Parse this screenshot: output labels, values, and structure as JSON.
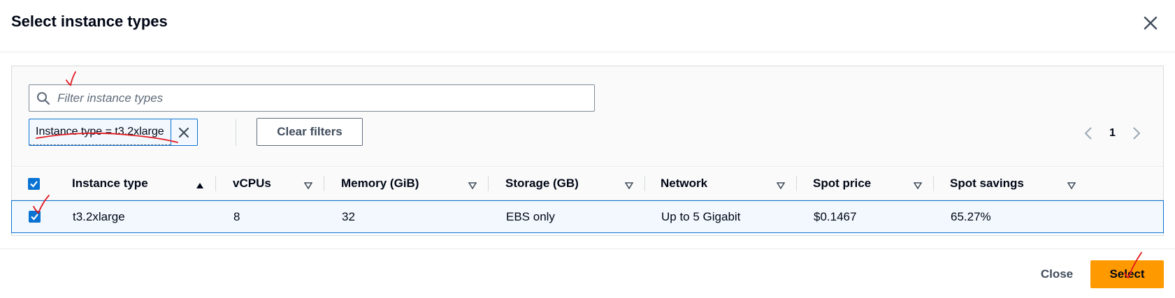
{
  "modal": {
    "title": "Select instance types",
    "close_icon": "close-icon"
  },
  "filter": {
    "placeholder": "Filter instance types",
    "search_icon": "search-icon",
    "token_label": "Instance type = t3.2xlarge",
    "clear_label": "Clear filters"
  },
  "pagination": {
    "current_page": "1"
  },
  "table": {
    "columns": [
      {
        "label": "Instance type",
        "sort": "ascending"
      },
      {
        "label": "vCPUs",
        "sort": "none"
      },
      {
        "label": "Memory (GiB)",
        "sort": "none"
      },
      {
        "label": "Storage (GB)",
        "sort": "none"
      },
      {
        "label": "Network",
        "sort": "none"
      },
      {
        "label": "Spot price",
        "sort": "none"
      },
      {
        "label": "Spot savings",
        "sort": "none"
      }
    ],
    "rows": [
      {
        "selected": true,
        "cells": [
          "t3.2xlarge",
          "8",
          "32",
          "EBS only",
          "Up to 5 Gigabit",
          "$0.1467",
          "65.27%"
        ]
      }
    ]
  },
  "footer": {
    "close_label": "Close",
    "select_label": "Select"
  },
  "colors": {
    "primary_button": "#ff9900",
    "accent_blue": "#0972d3",
    "annotation_red": "#e3171d"
  }
}
